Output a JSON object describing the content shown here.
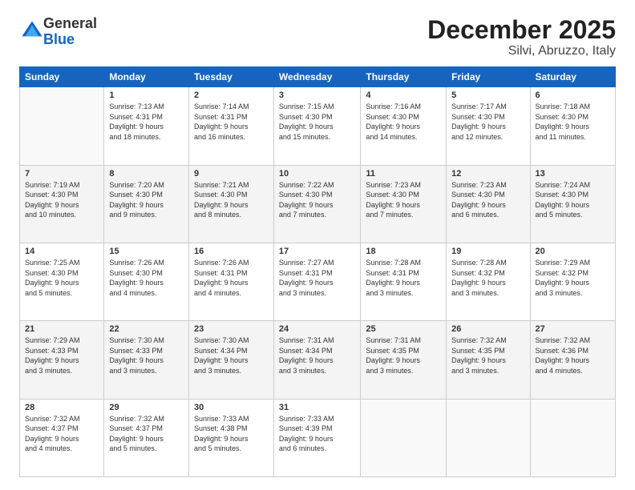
{
  "header": {
    "logo_general": "General",
    "logo_blue": "Blue",
    "month": "December 2025",
    "location": "Silvi, Abruzzo, Italy"
  },
  "weekdays": [
    "Sunday",
    "Monday",
    "Tuesday",
    "Wednesday",
    "Thursday",
    "Friday",
    "Saturday"
  ],
  "weeks": [
    [
      {
        "num": "",
        "info": ""
      },
      {
        "num": "1",
        "info": "Sunrise: 7:13 AM\nSunset: 4:31 PM\nDaylight: 9 hours\nand 18 minutes."
      },
      {
        "num": "2",
        "info": "Sunrise: 7:14 AM\nSunset: 4:31 PM\nDaylight: 9 hours\nand 16 minutes."
      },
      {
        "num": "3",
        "info": "Sunrise: 7:15 AM\nSunset: 4:30 PM\nDaylight: 9 hours\nand 15 minutes."
      },
      {
        "num": "4",
        "info": "Sunrise: 7:16 AM\nSunset: 4:30 PM\nDaylight: 9 hours\nand 14 minutes."
      },
      {
        "num": "5",
        "info": "Sunrise: 7:17 AM\nSunset: 4:30 PM\nDaylight: 9 hours\nand 12 minutes."
      },
      {
        "num": "6",
        "info": "Sunrise: 7:18 AM\nSunset: 4:30 PM\nDaylight: 9 hours\nand 11 minutes."
      }
    ],
    [
      {
        "num": "7",
        "info": "Sunrise: 7:19 AM\nSunset: 4:30 PM\nDaylight: 9 hours\nand 10 minutes."
      },
      {
        "num": "8",
        "info": "Sunrise: 7:20 AM\nSunset: 4:30 PM\nDaylight: 9 hours\nand 9 minutes."
      },
      {
        "num": "9",
        "info": "Sunrise: 7:21 AM\nSunset: 4:30 PM\nDaylight: 9 hours\nand 8 minutes."
      },
      {
        "num": "10",
        "info": "Sunrise: 7:22 AM\nSunset: 4:30 PM\nDaylight: 9 hours\nand 7 minutes."
      },
      {
        "num": "11",
        "info": "Sunrise: 7:23 AM\nSunset: 4:30 PM\nDaylight: 9 hours\nand 7 minutes."
      },
      {
        "num": "12",
        "info": "Sunrise: 7:23 AM\nSunset: 4:30 PM\nDaylight: 9 hours\nand 6 minutes."
      },
      {
        "num": "13",
        "info": "Sunrise: 7:24 AM\nSunset: 4:30 PM\nDaylight: 9 hours\nand 5 minutes."
      }
    ],
    [
      {
        "num": "14",
        "info": "Sunrise: 7:25 AM\nSunset: 4:30 PM\nDaylight: 9 hours\nand 5 minutes."
      },
      {
        "num": "15",
        "info": "Sunrise: 7:26 AM\nSunset: 4:30 PM\nDaylight: 9 hours\nand 4 minutes."
      },
      {
        "num": "16",
        "info": "Sunrise: 7:26 AM\nSunset: 4:31 PM\nDaylight: 9 hours\nand 4 minutes."
      },
      {
        "num": "17",
        "info": "Sunrise: 7:27 AM\nSunset: 4:31 PM\nDaylight: 9 hours\nand 3 minutes."
      },
      {
        "num": "18",
        "info": "Sunrise: 7:28 AM\nSunset: 4:31 PM\nDaylight: 9 hours\nand 3 minutes."
      },
      {
        "num": "19",
        "info": "Sunrise: 7:28 AM\nSunset: 4:32 PM\nDaylight: 9 hours\nand 3 minutes."
      },
      {
        "num": "20",
        "info": "Sunrise: 7:29 AM\nSunset: 4:32 PM\nDaylight: 9 hours\nand 3 minutes."
      }
    ],
    [
      {
        "num": "21",
        "info": "Sunrise: 7:29 AM\nSunset: 4:33 PM\nDaylight: 9 hours\nand 3 minutes."
      },
      {
        "num": "22",
        "info": "Sunrise: 7:30 AM\nSunset: 4:33 PM\nDaylight: 9 hours\nand 3 minutes."
      },
      {
        "num": "23",
        "info": "Sunrise: 7:30 AM\nSunset: 4:34 PM\nDaylight: 9 hours\nand 3 minutes."
      },
      {
        "num": "24",
        "info": "Sunrise: 7:31 AM\nSunset: 4:34 PM\nDaylight: 9 hours\nand 3 minutes."
      },
      {
        "num": "25",
        "info": "Sunrise: 7:31 AM\nSunset: 4:35 PM\nDaylight: 9 hours\nand 3 minutes."
      },
      {
        "num": "26",
        "info": "Sunrise: 7:32 AM\nSunset: 4:35 PM\nDaylight: 9 hours\nand 3 minutes."
      },
      {
        "num": "27",
        "info": "Sunrise: 7:32 AM\nSunset: 4:36 PM\nDaylight: 9 hours\nand 4 minutes."
      }
    ],
    [
      {
        "num": "28",
        "info": "Sunrise: 7:32 AM\nSunset: 4:37 PM\nDaylight: 9 hours\nand 4 minutes."
      },
      {
        "num": "29",
        "info": "Sunrise: 7:32 AM\nSunset: 4:37 PM\nDaylight: 9 hours\nand 5 minutes."
      },
      {
        "num": "30",
        "info": "Sunrise: 7:33 AM\nSunset: 4:38 PM\nDaylight: 9 hours\nand 5 minutes."
      },
      {
        "num": "31",
        "info": "Sunrise: 7:33 AM\nSunset: 4:39 PM\nDaylight: 9 hours\nand 6 minutes."
      },
      {
        "num": "",
        "info": ""
      },
      {
        "num": "",
        "info": ""
      },
      {
        "num": "",
        "info": ""
      }
    ]
  ]
}
